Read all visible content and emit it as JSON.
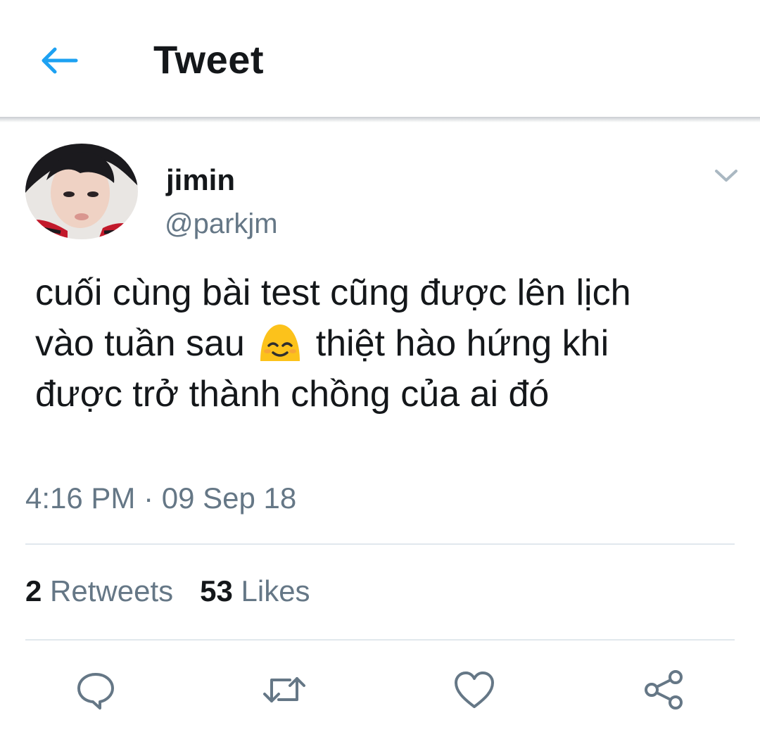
{
  "header": {
    "title": "Tweet",
    "back_icon": "arrow-left-icon",
    "accent_color": "#1da1f2"
  },
  "tweet": {
    "author_name": "jimin",
    "author_handle": "@parkjm",
    "text_part1": "cuối cùng bài test cũng được lên lịch vào tuần sau",
    "emoji": "smiling-face-with-smiling-eyes",
    "text_part2": "thiệt hào hứng khi được trở thành chồng của ai đó",
    "timestamp": "4:16 PM · 09 Sep 18"
  },
  "stats": {
    "retweets_count": "2",
    "retweets_label": "Retweets",
    "likes_count": "53",
    "likes_label": "Likes"
  },
  "actions": {
    "reply_icon": "reply-icon",
    "retweet_icon": "retweet-icon",
    "like_icon": "heart-icon",
    "share_icon": "share-icon"
  },
  "colors": {
    "text_primary": "#14171a",
    "text_secondary": "#657786",
    "divider": "#e1e8ed"
  }
}
